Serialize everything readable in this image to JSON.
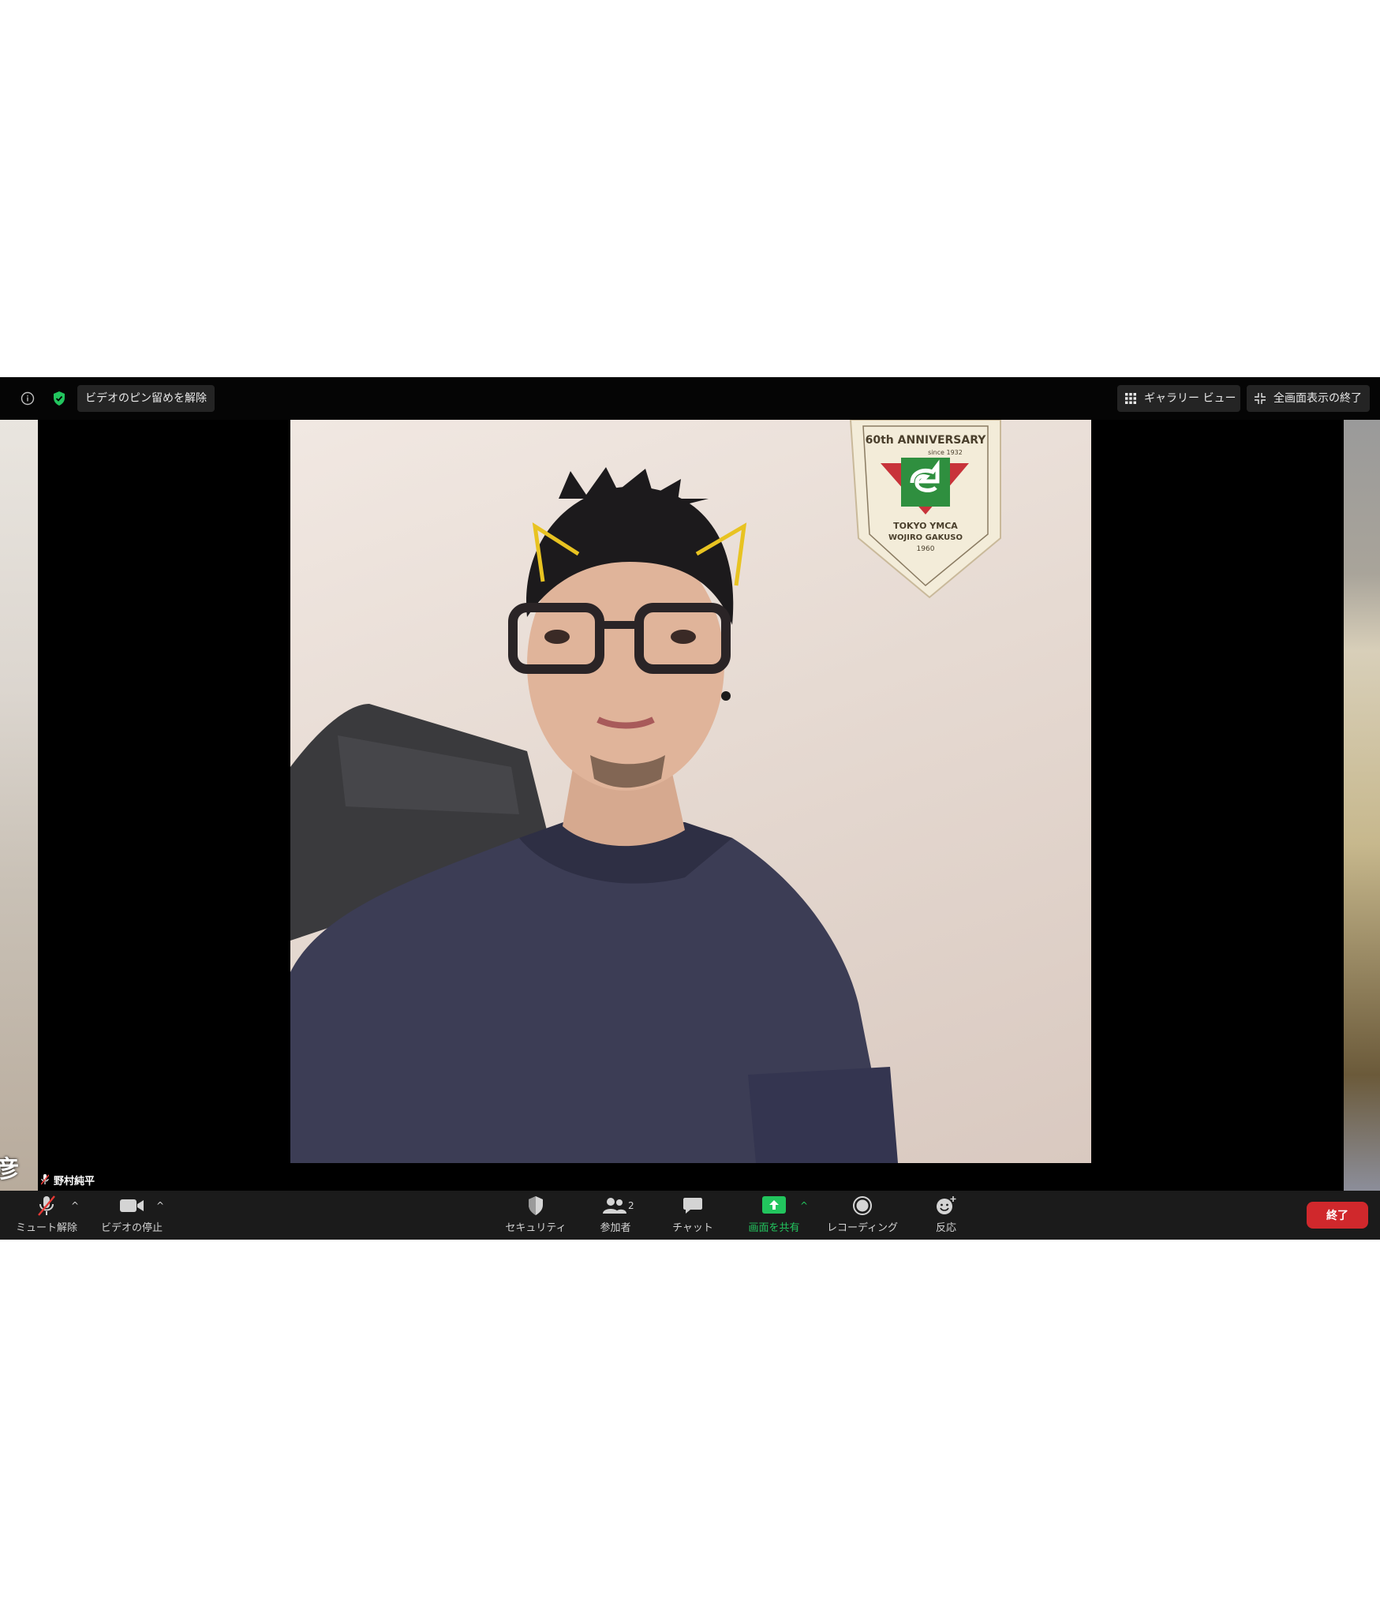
{
  "top_bar": {
    "unpin_video_label": "ビデオのピン留めを解除",
    "gallery_view_label": "ギャラリー ビュー",
    "exit_fullscreen_label": "全画面表示の終了"
  },
  "video": {
    "active_speaker_name": "野村純平",
    "left_thumbnail_name_fragment": "彦",
    "pennant_text_top": "60th ANNIVERSARY",
    "pennant_text_since": "since 1932",
    "pennant_text_line1": "TOKYO YMCA",
    "pennant_text_line2": "WOJIRO GAKUSO",
    "pennant_text_year": "1960"
  },
  "toolbar": {
    "mute_label": "ミュート解除",
    "video_label": "ビデオの停止",
    "security_label": "セキュリティ",
    "participants_label": "参加者",
    "participants_count": "2",
    "chat_label": "チャット",
    "share_label": "画面を共有",
    "record_label": "レコーディング",
    "reactions_label": "反応",
    "end_label": "終了"
  },
  "colors": {
    "share_green": "#22c55e",
    "end_red": "#d0282c",
    "toolbar_bg": "#1b1b1b"
  }
}
